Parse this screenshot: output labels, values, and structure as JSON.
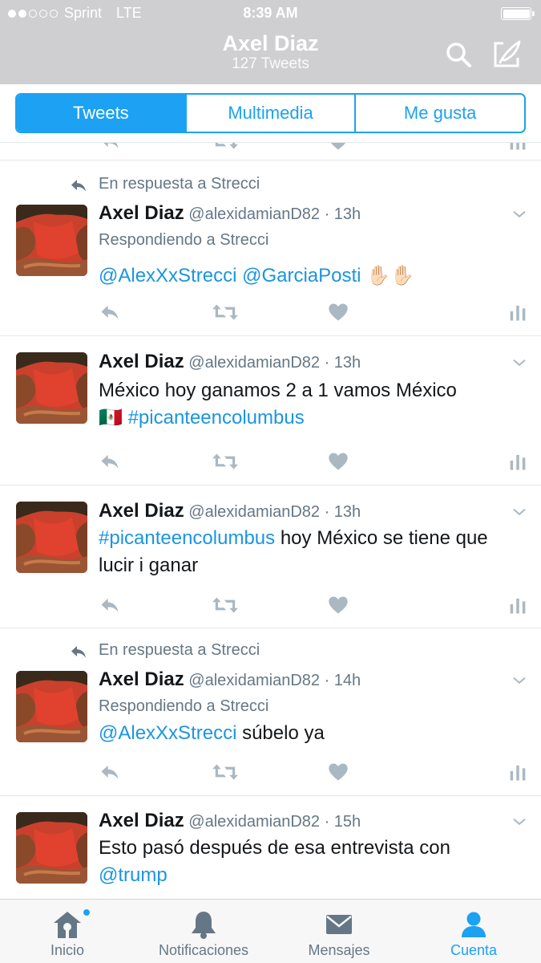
{
  "status_bar": {
    "carrier": "Sprint",
    "network": "LTE",
    "time": "8:39 AM"
  },
  "profile": {
    "name": "Axel Diaz",
    "tweet_count": "127 Tweets"
  },
  "tabs": [
    {
      "label": "Tweets",
      "active": true
    },
    {
      "label": "Multimedia",
      "active": false
    },
    {
      "label": "Me gusta",
      "active": false
    }
  ],
  "tweets": [
    {
      "context": "En respuesta a Strecci",
      "name": "Axel Diaz",
      "handle": "@alexidamianD82",
      "time": "· 13h",
      "replying": "Respondiendo a Strecci",
      "mention1": "@AlexXxStrecci",
      "mention2": "@GarciaPosti",
      "emoji": "✋🏻✋🏻"
    },
    {
      "name": "Axel Diaz",
      "handle": "@alexidamianD82",
      "time": "· 13h",
      "line1": "México hoy ganamos 2 a 1 vamos México",
      "flag": "🇲🇽",
      "hashtag": "#picanteencolumbus"
    },
    {
      "name": "Axel Diaz",
      "handle": "@alexidamianD82",
      "time": "· 13h",
      "hashtag": "#picanteencolumbus",
      "text_after": " hoy México se tiene que lucir i ganar"
    },
    {
      "context": "En respuesta a Strecci",
      "name": "Axel Diaz",
      "handle": "@alexidamianD82",
      "time": "· 14h",
      "replying": "Respondiendo a Strecci",
      "mention": "@AlexXxStrecci",
      "text_after": " súbelo ya"
    },
    {
      "name": "Axel Diaz",
      "handle": "@alexidamianD82",
      "time": "· 15h",
      "line1": "Esto pasó después de esa entrevista con",
      "mention": "@trump"
    }
  ],
  "tabbar": [
    {
      "label": "Inicio",
      "icon": "home-icon",
      "active": false
    },
    {
      "label": "Notificaciones",
      "icon": "bell-icon",
      "active": false
    },
    {
      "label": "Mensajes",
      "icon": "envelope-icon",
      "active": false
    },
    {
      "label": "Cuenta",
      "icon": "person-icon",
      "active": true
    }
  ],
  "colors": {
    "accent": "#1da1f2",
    "link": "#1b95e0",
    "header": "#cfcfd1",
    "muted": "#657786",
    "icon": "#aab8c2"
  }
}
